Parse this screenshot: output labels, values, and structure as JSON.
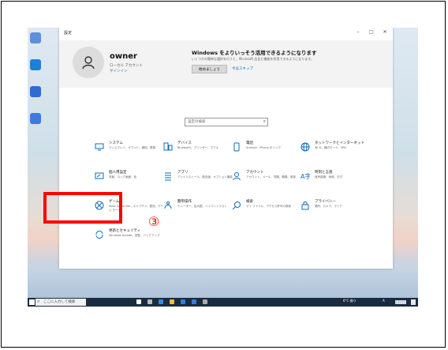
{
  "window": {
    "title": "設定",
    "controls": [
      "–",
      "□",
      "✕"
    ]
  },
  "account": {
    "name": "owner",
    "type": "ローカル アカウント",
    "signin_link": "サインイン"
  },
  "promo": {
    "title": "Windows をよりいっそう活用できるようになります",
    "subtitle": "いくつかの簡単な選択を行うと、Microsoft 広告と機能を利用できるようになります。",
    "primary_button": "始めましょう",
    "skip_link": "今はスキップ"
  },
  "search": {
    "placeholder": "設定の検索"
  },
  "tiles": [
    {
      "icon": "display-icon",
      "title": "システム",
      "desc": "ディスプレイ、サウンド、通知、電源"
    },
    {
      "icon": "devices-icon",
      "title": "デバイス",
      "desc": "Bluetooth、プリンター、マウス"
    },
    {
      "icon": "phone-icon",
      "title": "電話",
      "desc": "Android、iPhone のリンク"
    },
    {
      "icon": "globe-icon",
      "title": "ネットワークとインターネット",
      "desc": "Wi-Fi、機内モード、VPN"
    },
    {
      "icon": "personalization-icon",
      "title": "個人用設定",
      "desc": "背景、ロック画面、色"
    },
    {
      "icon": "apps-icon",
      "title": "アプリ",
      "desc": "アンインストール、既定値、オプション機能"
    },
    {
      "icon": "person-icon",
      "title": "アカウント",
      "desc": "アカウント、メール、同期、職場、家族"
    },
    {
      "icon": "time-language-icon",
      "title": "時刻と言語",
      "desc": "音声認識、地域、日付"
    },
    {
      "icon": "xbox-icon",
      "title": "ゲーム",
      "desc": "Xbox Game Bar、キャプチャ、配信、ゲーム モード"
    },
    {
      "icon": "ease-of-access-icon",
      "title": "簡単操作",
      "desc": "ナレーター、拡大鏡、ハイコントラスト"
    },
    {
      "icon": "search-icon",
      "title": "検索",
      "desc": "マイ ファイル、アクセス許可の検索"
    },
    {
      "icon": "lock-icon",
      "title": "プライバシー",
      "desc": "場所、カメラ、マイク"
    },
    {
      "icon": "sync-icon",
      "title": "更新とセキュリティ",
      "desc": "Windows Update、回復、バックアップ"
    }
  ],
  "annotation": {
    "marker": "③",
    "color": "#ff0000"
  },
  "taskbar": {
    "search_placeholder": "ここに入力して検索",
    "weather": "6°C 曇り",
    "ime": "A"
  },
  "colors": {
    "accent": "#0a6dbd",
    "taskbar": "#1b2b3f",
    "highlight": "#ff0000"
  }
}
